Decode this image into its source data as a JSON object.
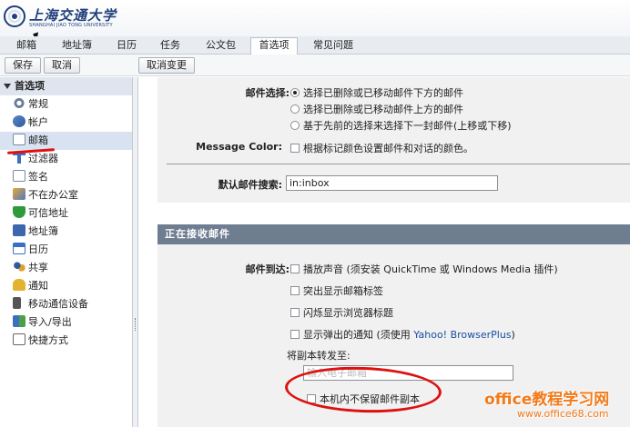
{
  "logo": {
    "title": "上海交通大学",
    "subtitle": "SHANGHAI JIAO TONG UNIVERSITY"
  },
  "tabs": [
    {
      "label": "邮箱"
    },
    {
      "label": "地址簿"
    },
    {
      "label": "日历"
    },
    {
      "label": "任务"
    },
    {
      "label": "公文包"
    },
    {
      "label": "首选项",
      "active": true
    },
    {
      "label": "常见问题"
    }
  ],
  "toolbar": {
    "save_label": "保存",
    "cancel_label": "取消",
    "undo_label": "取消变更"
  },
  "sidebar": {
    "header": "首选项",
    "items": [
      {
        "label": "常规",
        "icon": "gear-icon"
      },
      {
        "label": "帐户",
        "icon": "accounts-icon"
      },
      {
        "label": "邮箱",
        "icon": "envelope-icon",
        "selected": true
      },
      {
        "label": "过滤器",
        "icon": "filter-icon"
      },
      {
        "label": "签名",
        "icon": "signature-icon"
      },
      {
        "label": "不在办公室",
        "icon": "out-of-office-icon"
      },
      {
        "label": "可信地址",
        "icon": "shield-icon"
      },
      {
        "label": "地址簿",
        "icon": "addressbook-icon"
      },
      {
        "label": "日历",
        "icon": "calendar-icon"
      },
      {
        "label": "共享",
        "icon": "sharing-icon"
      },
      {
        "label": "通知",
        "icon": "bell-icon"
      },
      {
        "label": "移动通信设备",
        "icon": "mobile-icon"
      },
      {
        "label": "导入/导出",
        "icon": "import-export-icon"
      },
      {
        "label": "快捷方式",
        "icon": "keyboard-icon"
      }
    ]
  },
  "mail_selection": {
    "label": "邮件选择:",
    "options": [
      {
        "label": "选择已删除或已移动邮件下方的邮件",
        "checked": true
      },
      {
        "label": "选择已删除或已移动邮件上方的邮件",
        "checked": false
      },
      {
        "label": "基于先前的选择来选择下一封邮件(上移或下移)",
        "checked": false
      }
    ]
  },
  "message_color": {
    "label": "Message Color:",
    "option": "根据标记颜色设置邮件和对话的颜色。"
  },
  "default_search": {
    "label": "默认邮件搜索:",
    "value": "in:inbox"
  },
  "receiving": {
    "section_title": "正在接收邮件",
    "arrival_label": "邮件到达:",
    "options": [
      {
        "label": "播放声音 (须安装 QuickTime 或 Windows Media 插件)"
      },
      {
        "label": "突出显示邮箱标签"
      },
      {
        "label": "闪烁显示浏览器标题"
      },
      {
        "label": "显示弹出的通知 (须使用 ",
        "link": "Yahoo! BrowserPlus",
        "suffix": ")"
      }
    ],
    "forward_label": "将副本转发至:",
    "forward_placeholder": "输入电子邮箱",
    "keep_copy_label": "本机内不保留邮件副本"
  },
  "watermark": {
    "main": "office教程学习网",
    "url": "www.office68.com"
  },
  "colors": {
    "annotation": "#dd1111",
    "section_bar": "#6f7d91",
    "watermark": "#f27a1a"
  }
}
